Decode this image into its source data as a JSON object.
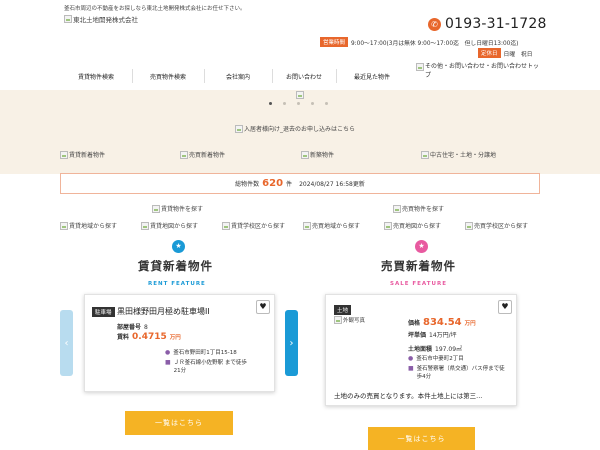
{
  "header": {
    "tagline": "釜石市周辺の不動産をお探しなら東北土地開発株式会社にお任せ下さい。",
    "logo_alt": "東北土地開発株式会社",
    "phone": "0193-31-1728",
    "hours_tag": "営業時間",
    "hours_text": "9:00～17:00(3月は無休 9:00～17:00迄　但し日曜日13:00迄)",
    "closed_tag": "定休日",
    "closed_text": "日曜　祝日",
    "contact_link": "その他・お問い合わせ・お問い合わせトップ"
  },
  "nav": {
    "items": [
      {
        "label": "賃貸物件検索"
      },
      {
        "label": "売買物件検索"
      },
      {
        "label": "会社案内"
      },
      {
        "label": "お問い合わせ"
      },
      {
        "label": "最近見た物件"
      }
    ]
  },
  "hero": {
    "slide_count": 5,
    "active_slide": 1,
    "banner_alt": "入居者様向け_退去のお申し込みはこちら"
  },
  "categories": [
    {
      "label": "賃貸新着物件"
    },
    {
      "label": "売買新着物件"
    },
    {
      "label": "新築物件"
    },
    {
      "label": "中古住宅・土地・分譲地"
    }
  ],
  "count_bar": {
    "prefix": "総物件数",
    "count": "620",
    "suffix": "件",
    "updated": "2024/08/27  16:58更新"
  },
  "search": {
    "rent_head": "賃貸物件を探す",
    "sale_head": "売買物件を探す",
    "rent_links": [
      {
        "label": "賃貸地域から探す"
      },
      {
        "label": "賃貸地図から探す"
      },
      {
        "label": "賃貸学校区から探す"
      }
    ],
    "sale_links": [
      {
        "label": "売買地域から探す"
      },
      {
        "label": "売買地図から探す"
      },
      {
        "label": "売買学校区から探す"
      }
    ]
  },
  "rent_section": {
    "title": "賃貸新着物件",
    "subtitle": "RENT FEATURE",
    "icon_color": "#1a9ad6",
    "card": {
      "tag": "駐車場",
      "title": "黒田様野田月極め駐車場II",
      "room_label": "部屋番号",
      "room": "8",
      "rent_label": "賃料",
      "rent": "0.4715",
      "rent_unit": "万円",
      "address": "釜石市野田町1丁目15-18",
      "station": "ＪＲ釜石線小佐野駅 まで徒歩21分"
    },
    "button": "一覧はこちら"
  },
  "sale_section": {
    "title": "売買新着物件",
    "subtitle": "SALE FEATURE",
    "icon_color": "#e85aa0",
    "card": {
      "tag": "土地",
      "photo_alt": "外観写真",
      "price_label": "価格",
      "price": "834.54",
      "price_unit": "万円",
      "tsubo_label": "坪単価",
      "tsubo": "14万円/坪",
      "area_label": "土地面積",
      "area": "197.09㎡",
      "address": "釜石市中妻町2丁目",
      "station": "釜石警察署（県交通）バス停まで徒歩4分",
      "description": "土地のみの売買となります。本件土地上には第三..."
    },
    "button": "一覧はこちら"
  },
  "colors": {
    "accent": "#e8672c",
    "nav_arrow": "#1a9ad6",
    "nav_arrow_light": "#b8dcef",
    "button": "#f5b324",
    "beige": "#f8f1e6"
  }
}
